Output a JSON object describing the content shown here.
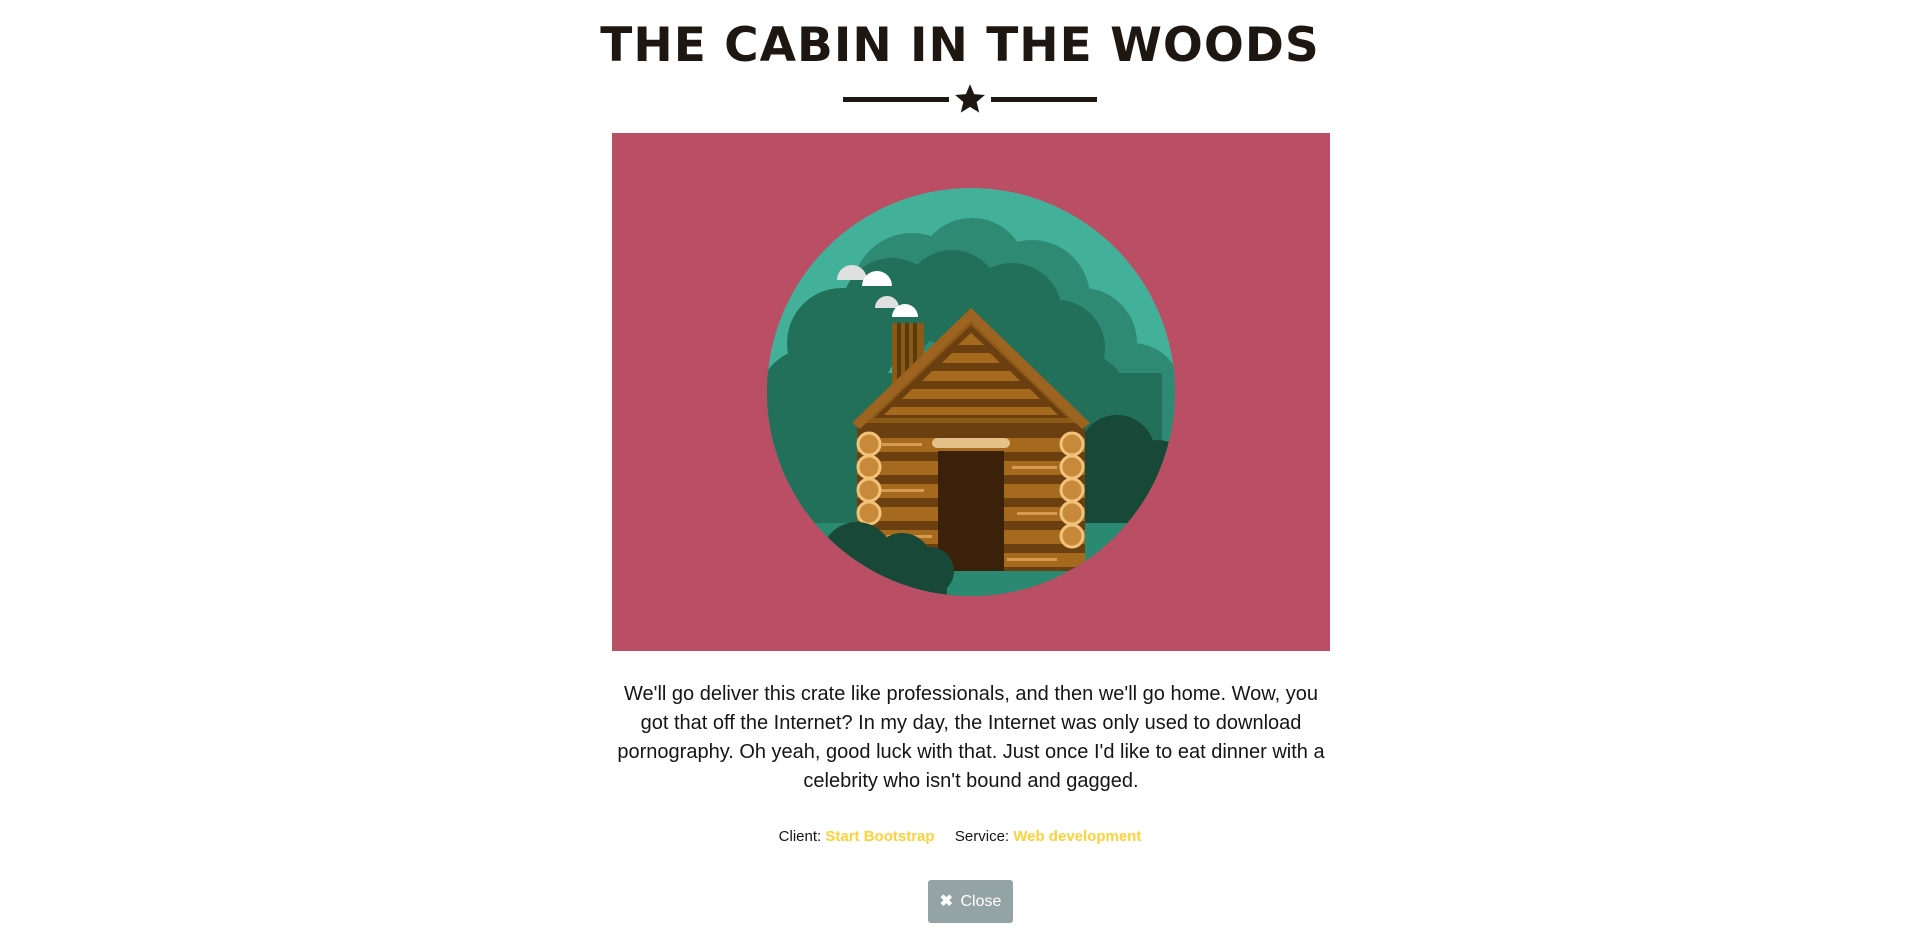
{
  "modal": {
    "title": "THE CABIN IN THE WOODS",
    "divider_icon": "star-icon",
    "image": {
      "subject": "cabin-illustration",
      "background_color": "#b94e64"
    },
    "description": "We'll go deliver this crate like professionals, and then we'll go home. Wow, you got that off the Internet? In my day, the Internet was only used to download pornography. Oh yeah, good luck with that. Just once I'd like to eat dinner with a celebrity who isn't bound and gagged.",
    "meta": {
      "client_label": "Client:",
      "client_value": "Start Bootstrap",
      "service_label": "Service:",
      "service_value": "Web development"
    },
    "close_button": {
      "icon": "close-icon",
      "icon_glyph": "✖",
      "label": "Close"
    }
  },
  "colors": {
    "heading": "#1e1711",
    "accent": "#fed136",
    "button": "#94a3a4",
    "image_background": "#b94e64"
  }
}
